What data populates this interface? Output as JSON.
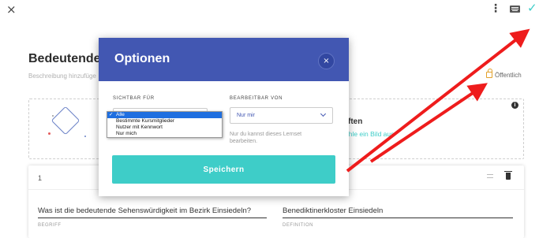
{
  "toolbar": {
    "close_glyph": "×",
    "more_glyph": "⋮",
    "confirm_glyph": "✓"
  },
  "page": {
    "title": "Bedeutende",
    "description_placeholder": "Beschreibung hinzufüge",
    "visibility_badge": "Öffentlich"
  },
  "upload": {
    "title": "ften",
    "link": "ähle ein Bild aus",
    "info_glyph": "i"
  },
  "card": {
    "number": "1",
    "term": "Was ist die bedeutende Sehenswürdigkeit im Bezirk Einsiedeln?",
    "term_label": "BEGRIFF",
    "definition": "Benediktinerkloster Einsiedeln",
    "definition_label": "DEFINITION"
  },
  "modal": {
    "title": "Optionen",
    "close_glyph": "×",
    "visible_for_label": "SICHTBAR FÜR",
    "visible_for_options": [
      "Alle",
      "Bestimmte Kursmitglieder",
      "Nutzer mit Kennwort",
      "Nur mich"
    ],
    "visible_for_selected_index": 0,
    "selected_tick": "✓",
    "editable_by_label": "BEARBEITBAR VON",
    "editable_by_value": "Nur mir",
    "editable_by_hint": "Nur du kannst dieses Lernset bearbeiten.",
    "save_label": "Speichern"
  },
  "colors": {
    "modal_header": "#4257b2",
    "accent_teal": "#3ecdc8",
    "annotation_arrow": "#ee1c1c",
    "lock": "#e2a12b"
  },
  "icons": [
    "close-icon",
    "more-vert-icon",
    "keyboard-icon",
    "check-icon",
    "lock-icon",
    "info-icon",
    "drag-handle-icon",
    "trash-icon",
    "chevron-down-icon"
  ]
}
